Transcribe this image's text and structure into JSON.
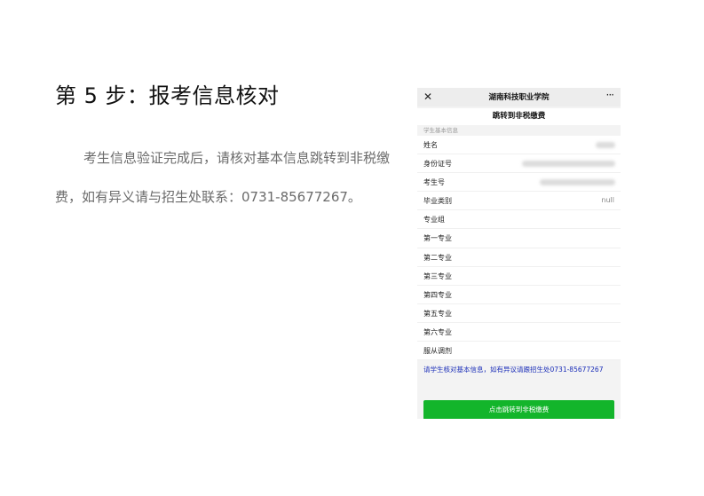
{
  "step": {
    "title": "第 5 步：报考信息核对"
  },
  "instruction": {
    "line1": "考生信息验证完成后，请核对基本信息跳转到非税缴",
    "line2": "费，如有异义请与招生处联系：0731-85677267。"
  },
  "phone": {
    "nav": {
      "close_icon": "close-icon",
      "title": "湖南科技职业学院",
      "more_icon": "more-icon",
      "more_glyph": "···"
    },
    "page_heading": "跳转到非税缴费",
    "section_label": "学生基本信息",
    "rows": [
      {
        "label": "姓名",
        "value": ""
      },
      {
        "label": "身份证号",
        "value": ""
      },
      {
        "label": "考生号",
        "value": ""
      },
      {
        "label": "毕业类别",
        "value": "null"
      },
      {
        "label": "专业组",
        "value": ""
      },
      {
        "label": "第一专业",
        "value": ""
      },
      {
        "label": "第二专业",
        "value": ""
      },
      {
        "label": "第三专业",
        "value": ""
      },
      {
        "label": "第四专业",
        "value": ""
      },
      {
        "label": "第五专业",
        "value": ""
      },
      {
        "label": "第六专业",
        "value": ""
      },
      {
        "label": "服从调剂",
        "value": ""
      }
    ],
    "notice": "请学生核对基本信息，如有异议请跟招生处0731-85677267",
    "button_label": "点击跳转到非税缴费",
    "colors": {
      "button": "#13b52b",
      "notice_text": "#1a2db8"
    }
  }
}
